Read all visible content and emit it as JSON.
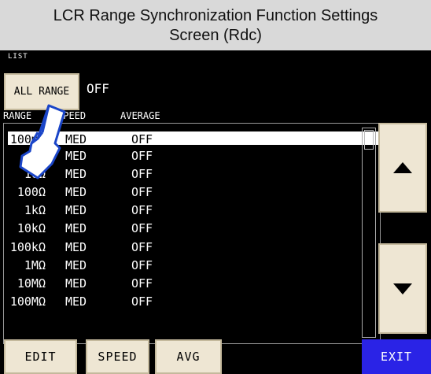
{
  "caption": {
    "line1": "LCR Range Synchronization Function Settings",
    "line2": "Screen (Rdc)"
  },
  "screen": {
    "list_label": "LIST",
    "all_range": {
      "button_label": "ALL RANGE",
      "value": "OFF"
    },
    "columns": {
      "range": "RANGE",
      "speed": "SPEED",
      "average": "AVERAGE"
    },
    "rows": [
      {
        "range": "100mΩ",
        "speed": "MED",
        "average": "OFF"
      },
      {
        "range": "1Ω",
        "speed": "MED",
        "average": "OFF"
      },
      {
        "range": "10Ω",
        "speed": "MED",
        "average": "OFF"
      },
      {
        "range": "100Ω",
        "speed": "MED",
        "average": "OFF"
      },
      {
        "range": "1kΩ",
        "speed": "MED",
        "average": "OFF"
      },
      {
        "range": "10kΩ",
        "speed": "MED",
        "average": "OFF"
      },
      {
        "range": "100kΩ",
        "speed": "MED",
        "average": "OFF"
      },
      {
        "range": "1MΩ",
        "speed": "MED",
        "average": "OFF"
      },
      {
        "range": "10MΩ",
        "speed": "MED",
        "average": "OFF"
      },
      {
        "range": "100MΩ",
        "speed": "MED",
        "average": "OFF"
      }
    ],
    "buttons": {
      "edit": "EDIT",
      "speed": "SPEED",
      "avg": "AVG",
      "exit": "EXIT"
    },
    "icons": {
      "scroll_up": "up-triangle-icon",
      "scroll_down": "down-triangle-icon",
      "pointer": "pointing-hand-icon"
    },
    "colors": {
      "screen_bg": "#000000",
      "button_bg": "#eee6d3",
      "exit_bg": "#2a23e6",
      "caption_bg": "#d9d9d9"
    }
  }
}
